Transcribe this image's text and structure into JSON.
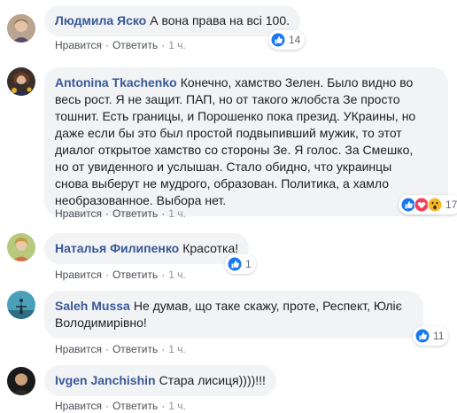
{
  "comments": [
    {
      "author": "Людмила Яско",
      "text": "А вона права на всі 100.",
      "like_label": "Нравится",
      "reply_label": "Ответить",
      "time": "1 ч.",
      "reaction_count": "14",
      "reaction_icons": [
        "like-icon"
      ]
    },
    {
      "author": "Antonina Tkachenko",
      "text": "Конечно, хамство Зелен. Было видно во\nвесь рост. Я не защит. ПАП, но от такого жлобста Зе просто\nтошнит. Есть границы, и Порошенко пока презид. УКраины, но\nдаже если бы это был простой подвыпивший мужик, то этот\nдиалог открытое хамство со стороны Зе. Я голос. За Смешко,\nно от увиденного и услышан. Стало обидно, что украинцы\nснова выберут не мудрого, образован. Политика, а хамло\nнеобразованное. Выбора нет.",
      "like_label": "Нравится",
      "reply_label": "Ответить",
      "time": "1 ч.",
      "reaction_count": "17",
      "reaction_icons": [
        "like-icon",
        "love-icon",
        "wow-icon"
      ]
    },
    {
      "author": "Наталья Филипенко",
      "text": "Красотка!",
      "like_label": "Нравится",
      "reply_label": "Ответить",
      "time": "1 ч.",
      "reaction_count": "1",
      "reaction_icons": [
        "like-icon"
      ]
    },
    {
      "author": "Saleh Mussa",
      "text": "Не думав, що таке скажу, проте, Респект, Юліє\nВолодимирівно!",
      "like_label": "Нравится",
      "reply_label": "Ответить",
      "time": "1 ч.",
      "reaction_count": "11",
      "reaction_icons": [
        "like-icon"
      ]
    },
    {
      "author": "Ivgen Janchishin",
      "text": "Стара лисиця))))!!!",
      "like_label": "Нравится",
      "reply_label": "Ответить",
      "time": "1 ч.",
      "reaction_count": "",
      "reaction_icons": []
    }
  ],
  "colors": {
    "author": "#385898",
    "bubble": "#f2f3f5",
    "like_blue": "#1877f2",
    "love_red": "#f33e58",
    "wow_yellow": "#f7b928"
  }
}
